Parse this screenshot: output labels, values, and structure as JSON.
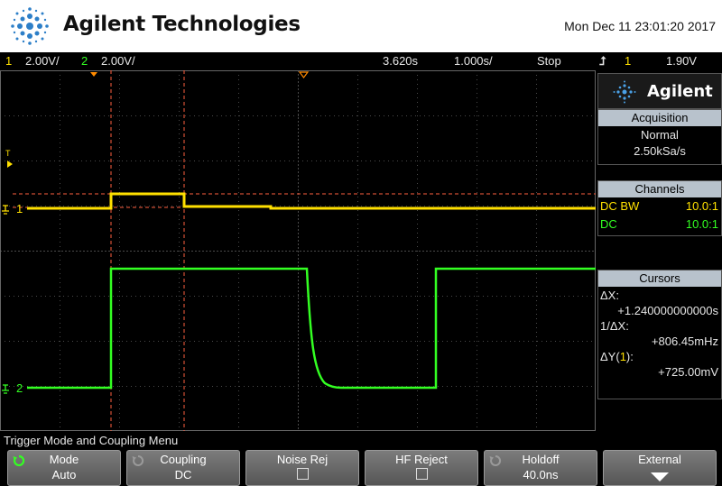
{
  "header": {
    "brand": "Agilent Technologies",
    "timestamp": "Mon Dec 11 23:01:20 2017"
  },
  "status": {
    "ch1_num": "1",
    "ch1_scale": "2.00V/",
    "ch2_num": "2",
    "ch2_scale": "2.00V/",
    "delay": "3.620s",
    "timebase": "1.000s/",
    "run_state": "Stop",
    "trigger_source": "1",
    "trigger_level": "1.90V"
  },
  "markers": {
    "trigger_level_marker": "T",
    "ch1_label": "1",
    "ch2_label": "2"
  },
  "panel": {
    "logo_text": "Agilent",
    "acquisition": {
      "title": "Acquisition",
      "mode": "Normal",
      "rate": "2.50kSa/s"
    },
    "channels": {
      "title": "Channels",
      "rows": [
        {
          "coupling": "DC BW",
          "probe": "10.0:1",
          "color": "#ffe000"
        },
        {
          "coupling": "DC",
          "probe": "10.0:1",
          "color": "#33ff22"
        }
      ]
    },
    "cursors": {
      "title": "Cursors",
      "dx_label": "ΔX:",
      "dx_value": "+1.240000000000s",
      "inv_dx_label": "1/ΔX:",
      "inv_dx_value": "+806.45mHz",
      "dy_label_prefix": "ΔY(",
      "dy_label_ch": "1",
      "dy_label_suffix": "):",
      "dy_value": "+725.00mV"
    }
  },
  "menu": {
    "title": "Trigger Mode and Coupling Menu",
    "softkeys": [
      {
        "label": "Mode",
        "value": "Auto",
        "icon": "rotate-knob-icon"
      },
      {
        "label": "Coupling",
        "value": "DC",
        "icon": "rotate-knob-icon"
      },
      {
        "label": "Noise Rej",
        "value": "",
        "icon": "checkbox"
      },
      {
        "label": "HF Reject",
        "value": "",
        "icon": "checkbox"
      },
      {
        "label": "Holdoff",
        "value": "40.0ns",
        "icon": "rotate-knob-icon"
      },
      {
        "label": "External",
        "value": "",
        "icon": "arrow-down-icon"
      }
    ]
  },
  "colors": {
    "ch1": "#ffe000",
    "ch2": "#33ff22",
    "cursor": "#ff6040",
    "grid": "#555555"
  }
}
